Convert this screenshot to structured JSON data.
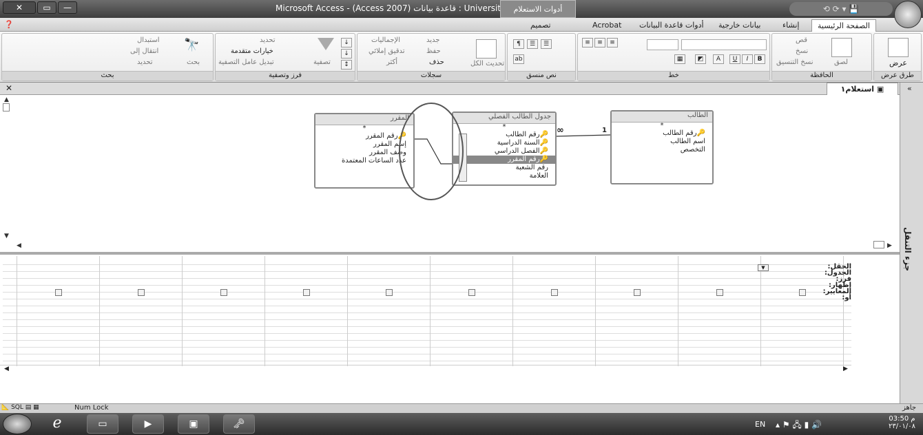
{
  "window": {
    "title": "Microsoft Access - (Access 2007) قاعدة بيانات : University",
    "context_tab": "أدوات الاستعلام",
    "close": "✕",
    "maximize": "▭",
    "minimize": "—",
    "office_button_icon": "office-logo-icon"
  },
  "ribbon_tabs": [
    "الصفحة الرئيسية",
    "إنشاء",
    "بيانات خارجية",
    "أدوات قاعدة البيانات",
    "Acrobat",
    "تصميم"
  ],
  "ribbon": {
    "views": {
      "label": "عرض",
      "group": "طرق عرض"
    },
    "clipboard": {
      "paste": "لصق",
      "cut": "قص",
      "copy": "نسخ",
      "format_painter": "نسخ التنسيق",
      "group": "الحافظة"
    },
    "font": {
      "group": "خط"
    },
    "rich_text": {
      "group": "نص منسق"
    },
    "records": {
      "refresh": "تحديث الكل",
      "new": "جديد",
      "save": "حفظ",
      "delete": "حذف",
      "totals": "الإجماليات",
      "spelling": "تدقيق إملائي",
      "more": "أكثر",
      "group": "سجلات"
    },
    "sort_filter": {
      "filter": "تصفية",
      "selection": "تحديد",
      "advanced": "خيارات متقدمة",
      "toggle_filter": "تبديل عامل التصفية",
      "group": "فرز وتصفية"
    },
    "find": {
      "find": "بحث",
      "replace": "استبدال",
      "goto": "انتقال إلى",
      "select": "تحديد",
      "group": "بحث"
    }
  },
  "document_tab": {
    "label": "استعلام١"
  },
  "tables": [
    {
      "title": "المقرر",
      "star": "*",
      "fields": [
        "رقم المقرر",
        "إسم المقرر",
        "وصف المقرر",
        "عدد الساعات المعتمدة"
      ],
      "key_fields": [
        0
      ]
    },
    {
      "title": "جدول الطالب الفصلي",
      "star": "*",
      "fields": [
        "رقم الطالب",
        "السنة الدراسية",
        "الفصل الدراسي",
        "رقم المقرر",
        "رقم الشعبة",
        "العلامة"
      ],
      "key_fields": [
        0,
        1,
        2,
        3
      ],
      "selected": 3
    },
    {
      "title": "الطالب",
      "star": "*",
      "fields": [
        "رقم الطالب",
        "اسم الطالب",
        "التخصص"
      ],
      "key_fields": [
        0
      ]
    }
  ],
  "relationship": {
    "one": "1",
    "many": "∞"
  },
  "grid": {
    "row_labels": [
      "الحقل:",
      "الجدول:",
      "فرز:",
      "إظهار:",
      "المعايير:",
      "أو:"
    ],
    "columns": 10
  },
  "nav_pane": {
    "label": "جزء التنقل"
  },
  "statusbar": {
    "left_status": "جاهز",
    "num_lock": "Num Lock",
    "view_icons": [
      "design-view-icon",
      "sql-view-icon",
      "pivot-chart-icon",
      "datasheet-icon"
    ]
  },
  "taskbar": {
    "lang": "EN",
    "time": "03:50 م",
    "date": "٢٣/٠١/٠٨"
  }
}
